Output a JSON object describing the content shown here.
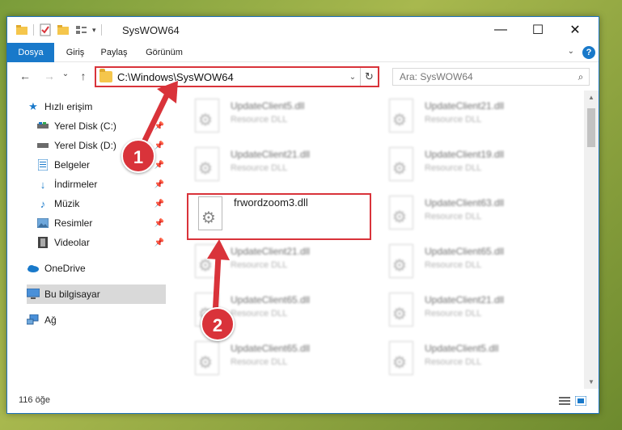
{
  "window": {
    "title": "SysWOW64"
  },
  "ribbon": {
    "tabs": [
      "Dosya",
      "Giriş",
      "Paylaş",
      "Görünüm"
    ],
    "help": "?"
  },
  "address": {
    "path": "C:\\Windows\\SysWOW64"
  },
  "search": {
    "placeholder": "Ara: SysWOW64"
  },
  "sidebar": {
    "items": [
      {
        "label": "Hızlı erişim",
        "icon": "star-icon"
      },
      {
        "label": "Yerel Disk (C:)",
        "icon": "drive-icon"
      },
      {
        "label": "Yerel Disk (D:)",
        "icon": "drive-icon"
      },
      {
        "label": "Belgeler",
        "icon": "documents-icon"
      },
      {
        "label": "İndirmeler",
        "icon": "download-icon"
      },
      {
        "label": "Müzik",
        "icon": "music-icon"
      },
      {
        "label": "Resimler",
        "icon": "pictures-icon"
      },
      {
        "label": "Videolar",
        "icon": "video-icon"
      },
      {
        "label": "OneDrive",
        "icon": "cloud-icon"
      },
      {
        "label": "Bu bilgisayar",
        "icon": "computer-icon"
      },
      {
        "label": "Ağ",
        "icon": "network-icon"
      }
    ]
  },
  "files": [
    {
      "name": "UpdateClient5.dll",
      "type": "Resource DLL"
    },
    {
      "name": "UpdateClient21.dll",
      "type": "Resource DLL"
    },
    {
      "name": "UpdateClient21.dll",
      "type": "Resource DLL"
    },
    {
      "name": "UpdateClient19.dll",
      "type": "Resource DLL"
    },
    {
      "name": "frwordzoom3.dll",
      "type": ""
    },
    {
      "name": "UpdateClient63.dll",
      "type": "Resource DLL"
    },
    {
      "name": "UpdateClient21.dll",
      "type": "Resource DLL"
    },
    {
      "name": "UpdateClient65.dll",
      "type": "Resource DLL"
    },
    {
      "name": "UpdateClient65.dll",
      "type": "Resource DLL"
    },
    {
      "name": "UpdateClient21.dll",
      "type": "Resource DLL"
    },
    {
      "name": "UpdateClient65.dll",
      "type": "Resource DLL"
    },
    {
      "name": "UpdateClient5.dll",
      "type": "Resource DLL"
    }
  ],
  "status": {
    "count": "116 öğe"
  },
  "markers": [
    "1",
    "2"
  ],
  "colors": {
    "accent": "#1979ca",
    "highlight": "#d9333a"
  }
}
